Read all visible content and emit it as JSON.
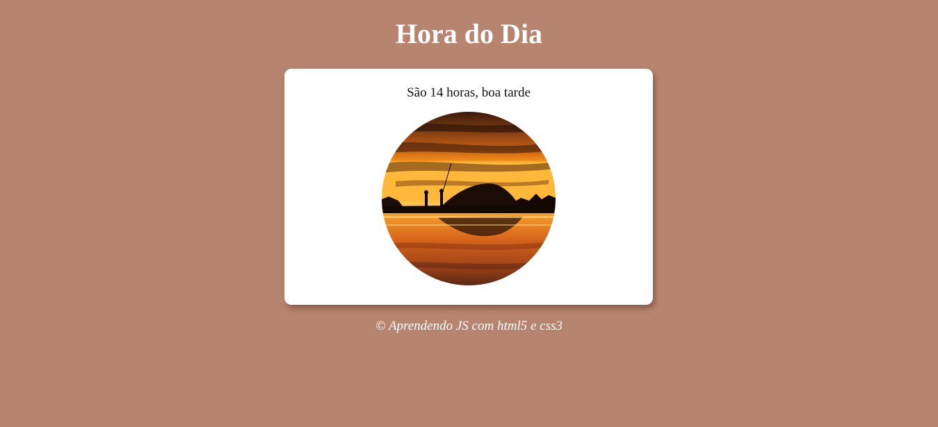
{
  "page": {
    "title": "Hora do Dia"
  },
  "card": {
    "message": "São 14 horas, boa tarde",
    "image_icon": "sunset-beach-photo"
  },
  "footer": {
    "text": "© Aprendendo JS com html5 e css3"
  },
  "colors": {
    "background": "#b7846f",
    "card": "#ffffff",
    "title": "#ffffff"
  }
}
